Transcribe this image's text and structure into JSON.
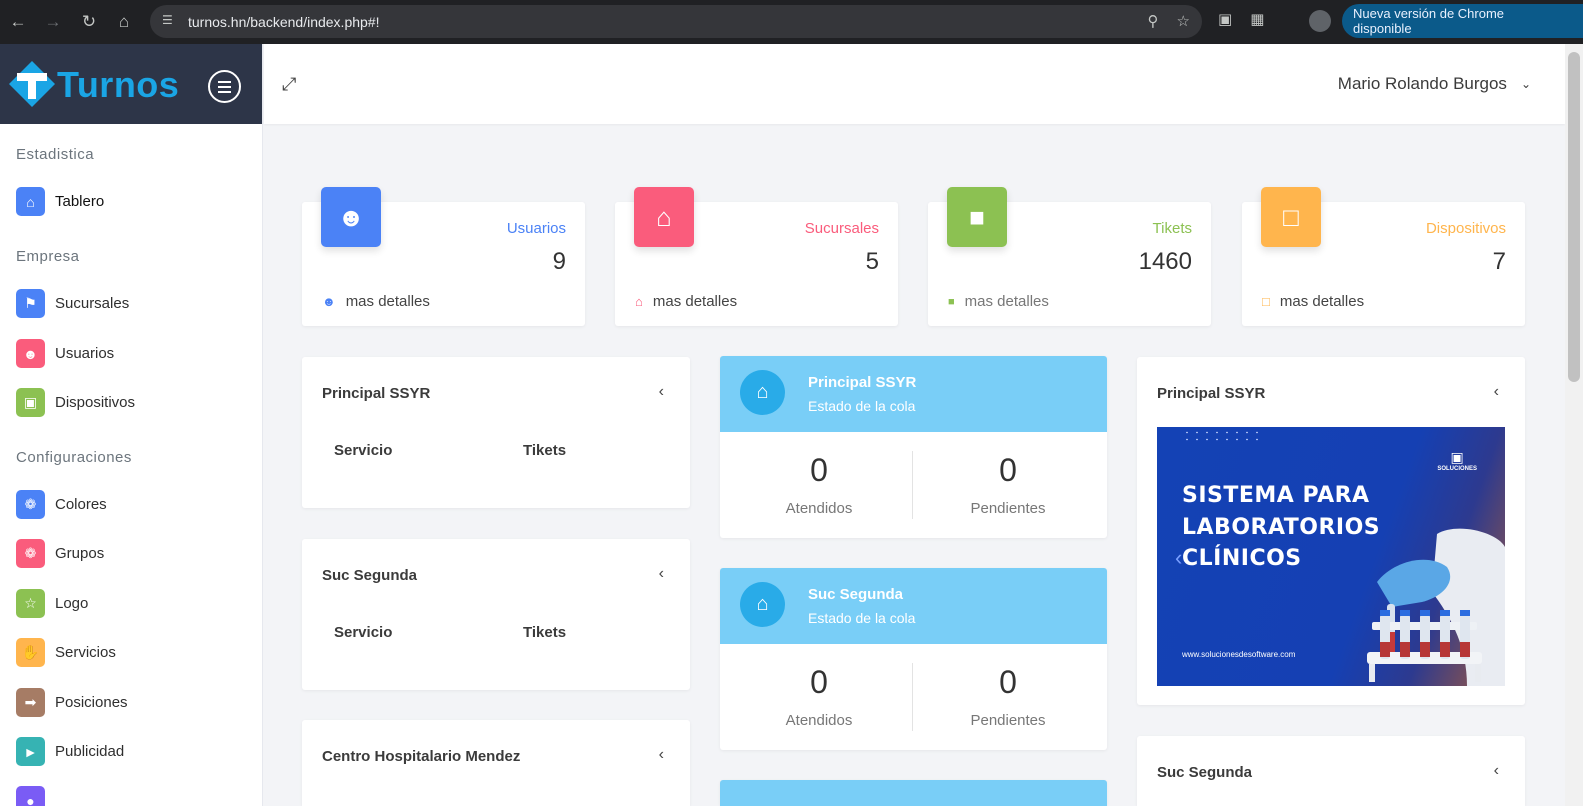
{
  "browser": {
    "url": "turnos.hn/backend/index.php#!",
    "update_button": "Nueva versión de Chrome disponible"
  },
  "sidebar": {
    "brand": "Turnos",
    "sections": [
      {
        "title": "Estadistica",
        "items": [
          {
            "label": "Tablero",
            "icon": "home-icon",
            "color": "#4b82f6"
          }
        ]
      },
      {
        "title": "Empresa",
        "items": [
          {
            "label": "Sucursales",
            "icon": "sign-icon",
            "color": "#4b82f6"
          },
          {
            "label": "Usuarios",
            "icon": "user-icon",
            "color": "#fa5c7c"
          },
          {
            "label": "Dispositivos",
            "icon": "tablet-icon",
            "color": "#8cc152"
          }
        ]
      },
      {
        "title": "Configuraciones",
        "items": [
          {
            "label": "Colores",
            "icon": "palette-icon",
            "color": "#4b82f6"
          },
          {
            "label": "Grupos",
            "icon": "palette-icon",
            "color": "#fa5c7c"
          },
          {
            "label": "Logo",
            "icon": "star-icon",
            "color": "#8cc152"
          },
          {
            "label": "Servicios",
            "icon": "hand-icon",
            "color": "#ffb54d"
          },
          {
            "label": "Posiciones",
            "icon": "signpost-icon",
            "color": "#a67c65"
          },
          {
            "label": "Publicidad",
            "icon": "megaphone-icon",
            "color": "#36b3b3"
          }
        ]
      }
    ]
  },
  "header": {
    "user_name": "Mario Rolando Burgos"
  },
  "stats": [
    {
      "label": "Usuarios",
      "value": "9",
      "footer": "mas detalles",
      "color": "#4b82f6",
      "icon": "users-icon"
    },
    {
      "label": "Sucursales",
      "value": "5",
      "footer": "mas detalles",
      "color": "#fa5c7c",
      "icon": "home-icon"
    },
    {
      "label": "Tikets",
      "value": "1460",
      "footer": "mas detalles",
      "color": "#8cc152",
      "icon": "ticket-icon"
    },
    {
      "label": "Dispositivos",
      "value": "7",
      "footer": "mas detalles",
      "color": "#ffb54d",
      "icon": "monitor-icon"
    }
  ],
  "service_panels": [
    {
      "title": "Principal SSYR",
      "col1": "Servicio",
      "col2": "Tikets"
    },
    {
      "title": "Suc Segunda",
      "col1": "Servicio",
      "col2": "Tikets"
    },
    {
      "title": "Centro Hospitalario Mendez"
    }
  ],
  "queues": [
    {
      "name": "Principal SSYR",
      "subtitle": "Estado de la cola",
      "attended": "0",
      "attended_label": "Atendidos",
      "pending": "0",
      "pending_label": "Pendientes"
    },
    {
      "name": "Suc Segunda",
      "subtitle": "Estado de la cola",
      "attended": "0",
      "attended_label": "Atendidos",
      "pending": "0",
      "pending_label": "Pendientes"
    }
  ],
  "ads": [
    {
      "title": "Principal SSYR",
      "line1": "SISTEMA PARA",
      "line2": "LABORATORIOS",
      "line3": "CLÍNICOS",
      "url": "www.solucionesdesoftware.com",
      "logo": "SOLUCIONES"
    },
    {
      "title": "Suc Segunda"
    }
  ]
}
